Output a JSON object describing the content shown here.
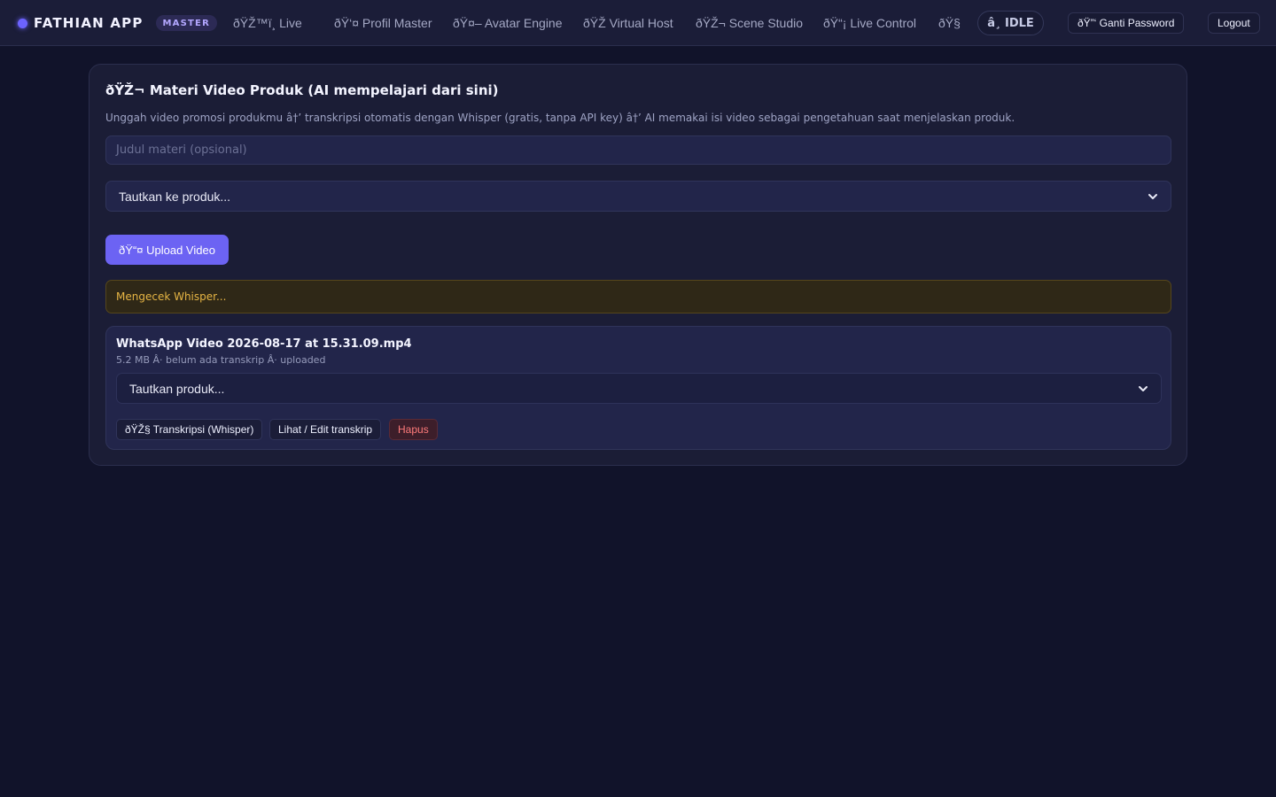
{
  "app": {
    "name": "FATHIAN APP",
    "role_badge": "MASTER"
  },
  "nav": {
    "items": [
      {
        "label": "ðŸŽ™ï¸ Live"
      },
      {
        "label": "ðŸ‘¤ Profil Master"
      },
      {
        "label": "ðŸ¤– Avatar Engine"
      },
      {
        "label": "ðŸŽ Virtual Host"
      },
      {
        "label": "ðŸŽ¬ Scene Studio"
      },
      {
        "label": "ðŸ“¡ Live Control"
      },
      {
        "label": "ðŸ§"
      }
    ],
    "status": "â¸ IDLE",
    "change_password": "ðŸ”‘ Ganti Password",
    "logout": "Logout"
  },
  "card": {
    "title": "ðŸŽ¬ Materi Video Produk (AI mempelajari dari sini)",
    "description": "Unggah video promosi produkmu â†’ transkripsi otomatis dengan Whisper (gratis, tanpa API key) â†’ AI memakai isi video sebagai pengetahuan saat menjelaskan produk.",
    "title_input_placeholder": "Judul materi (opsional)",
    "link_product_select": "Tautkan ke produk...",
    "upload_button": "ðŸ“¤ Upload Video",
    "whisper_status": "Mengecek Whisper..."
  },
  "videos": [
    {
      "filename": "WhatsApp Video 2026-08-17 at 15.31.09.mp4",
      "meta": "5.2 MB Â· belum ada transkrip Â· uploaded",
      "link_product_select": "Tautkan produk...",
      "transcribe_button": "ðŸŽ§ Transkripsi (Whisper)",
      "view_edit_button": "Lihat / Edit transkrip",
      "delete_button": "Hapus"
    }
  ],
  "colors": {
    "background": "#11132a",
    "topbar": "#1b1d38",
    "accent": "#6c63f3",
    "warning_text": "#e6b544",
    "danger_text": "#ff7b7b"
  }
}
